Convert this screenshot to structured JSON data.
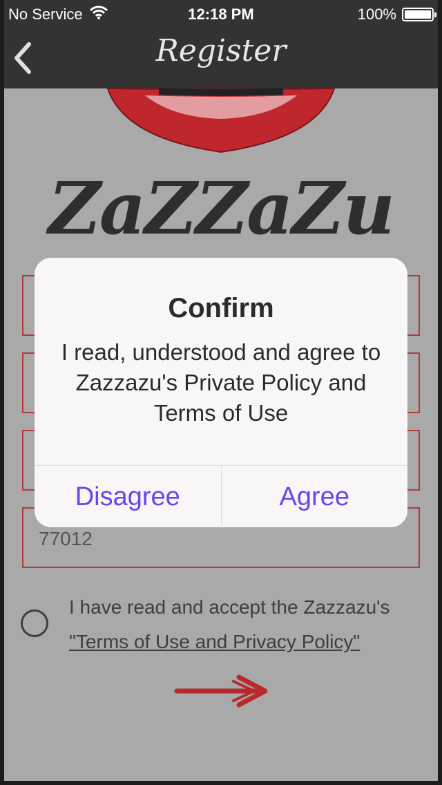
{
  "status_bar": {
    "carrier": "No Service",
    "time": "12:18 PM",
    "battery": "100%"
  },
  "nav": {
    "title": "Register"
  },
  "brand": {
    "name": "ZaZZaZu"
  },
  "form": {
    "zip_value": "77012",
    "terms_text": "I have read and accept the Zazzazu's",
    "terms_link": "\"Terms of Use and Privacy Policy\""
  },
  "alert": {
    "title": "Confirm",
    "message": "I read, understood and agree to Zazzazu's Private Policy and Terms of Use",
    "disagree_label": "Disagree",
    "agree_label": "Agree"
  },
  "colors": {
    "accent": "#6b44f0",
    "field_border": "#b53a3a",
    "nav_bg": "#333333",
    "overlay_bg": "#a9a9a9"
  }
}
